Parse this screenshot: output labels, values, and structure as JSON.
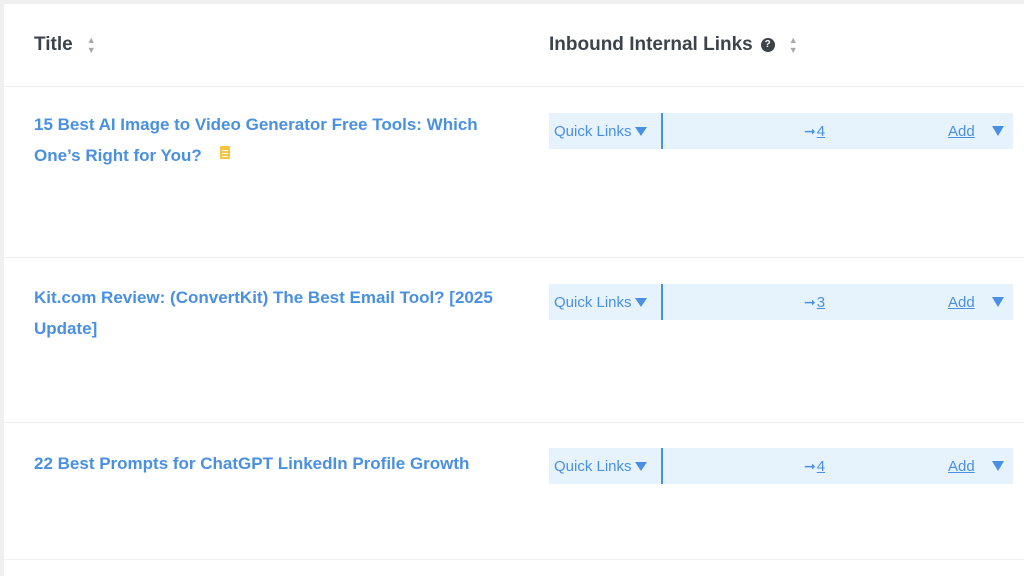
{
  "table": {
    "columns": {
      "title": "Title",
      "inbound": "Inbound Internal Links",
      "help_icon": "?"
    },
    "rows": [
      {
        "title": "15 Best AI Image to Video Generator Free Tools: Which One’s Right for You?",
        "has_doc_icon": true,
        "quick_links": "Quick Links",
        "arrow": "➞",
        "count": "4",
        "add": "Add"
      },
      {
        "title": "Kit.com Review: (ConvertKit) The Best Email Tool? [2025 Update]",
        "has_doc_icon": false,
        "quick_links": "Quick Links",
        "arrow": "➞",
        "count": "3",
        "add": "Add"
      },
      {
        "title": "22 Best Prompts for ChatGPT LinkedIn Profile Growth",
        "has_doc_icon": false,
        "quick_links": "Quick Links",
        "arrow": "➞",
        "count": "4",
        "add": "Add"
      }
    ]
  },
  "colors": {
    "link": "#4a90e2",
    "bar_bg": "#e6f3fd",
    "header_text": "#3c434a"
  }
}
